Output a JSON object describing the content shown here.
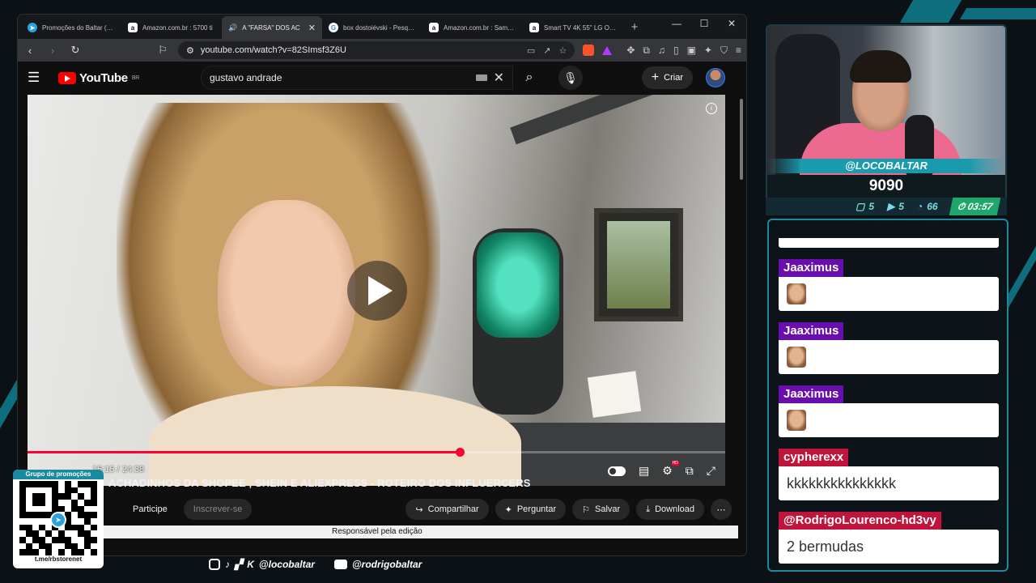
{
  "browser": {
    "tabs": [
      {
        "title": "Promoções do Baltar (Grupo)",
        "favicon": "telegram-icon",
        "active": false
      },
      {
        "title": "Amazon.com.br : 5700 ti",
        "favicon": "amazon-icon",
        "active": false
      },
      {
        "title": "A \"FARSA\" DOS AC",
        "favicon": "youtube-icon",
        "active": true,
        "audio": true
      },
      {
        "title": "box dostoiévski - Pesquisa Google",
        "favicon": "google-icon",
        "active": false
      },
      {
        "title": "Amazon.com.br : Samsung",
        "favicon": "amazon-icon",
        "active": false
      },
      {
        "title": "Smart TV 4K 55\" LG OLED e",
        "favicon": "amazon-icon",
        "active": false
      }
    ],
    "url": "youtube.com/watch?v=82SImsf3Z6U"
  },
  "youtube": {
    "logo_text": "YouTube",
    "region": "BR",
    "search_value": "gustavo andrade",
    "create_label": "Criar",
    "player": {
      "current_time": "15:15",
      "duration": "24:38",
      "progress": 0.619
    },
    "video_title": "ACHADINHOS DA SHOPEE , SHEIN E ALIEXPRESS - ROTEIRO DOS INFLUERCERS",
    "actions": {
      "join": "Participe",
      "subscribe": "Inscrever-se",
      "share": "Compartilhar",
      "ask": "Perguntar",
      "save": "Salvar",
      "download": "Download"
    },
    "tooltip": "Responsável pela edição"
  },
  "stream": {
    "promo_title": "Grupo de promoções",
    "promo_link": "t.me/rbstorenet",
    "social_handle_1": "@locobaltar",
    "social_handle_2": "@rodrigobaltar",
    "cam_handle": "@LOCOBALTAR",
    "followers": "9090",
    "stats": {
      "chat": "5",
      "youtube": "5",
      "viewers": "66",
      "timer": "03:57"
    }
  },
  "chat": {
    "messages": [
      {
        "user": "Jaaximus",
        "text": "",
        "emote": "face-emote",
        "color": "#6a0dad"
      },
      {
        "user": "Jaaximus",
        "text": "",
        "emote": "face-emote",
        "color": "#6a0dad"
      },
      {
        "user": "Jaaximus",
        "text": "",
        "emote": "face-emote",
        "color": "#6a0dad"
      },
      {
        "user": "cypherexx",
        "text": "kkkkkkkkkkkkkkk",
        "color": "#c1143a"
      },
      {
        "user": "@RodrigoLourenco-hd3vy",
        "text": "2 bermudas",
        "color": "#c1143a"
      }
    ]
  },
  "colors": {
    "accent": "#1a9aad",
    "yt_red": "#ff0033"
  }
}
